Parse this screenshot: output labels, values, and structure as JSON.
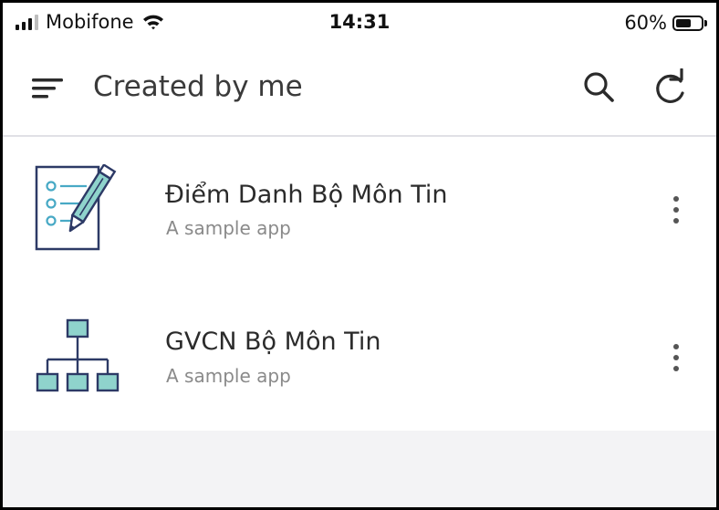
{
  "status_bar": {
    "carrier": "Mobifone",
    "time": "14:31",
    "battery_percent": "60%",
    "battery_level": 0.6,
    "signal_bars": 3
  },
  "header": {
    "title": "Created by me",
    "menu_icon": "hamburger-menu-icon",
    "search_icon": "search-icon",
    "refresh_icon": "refresh-icon"
  },
  "apps": [
    {
      "name": "Điểm Danh Bộ Môn Tin",
      "description": "A sample app",
      "icon": "checklist-pencil-icon"
    },
    {
      "name": "GVCN Bộ Môn Tin",
      "description": "A sample app",
      "icon": "org-chart-icon"
    }
  ],
  "colors": {
    "icon_stroke": "#2d3a66",
    "icon_fill": "#8fd3cc",
    "icon_accent": "#48a9c5",
    "divider": "#e0e0e6",
    "background": "#f3f3f5"
  }
}
